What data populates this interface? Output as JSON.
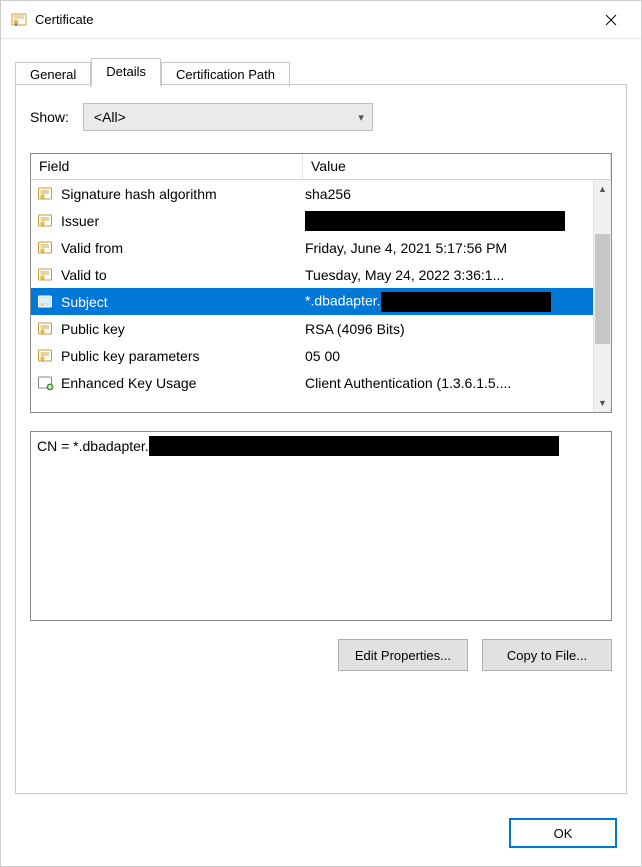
{
  "window": {
    "title": "Certificate"
  },
  "tabs": {
    "general": "General",
    "details": "Details",
    "certpath": "Certification Path"
  },
  "show": {
    "label": "Show:",
    "value": "<All>"
  },
  "columns": {
    "field": "Field",
    "value": "Value"
  },
  "rows": [
    {
      "field": "Signature hash algorithm",
      "value": "sha256",
      "icon": "cert-field-icon",
      "redacted": false
    },
    {
      "field": "Issuer",
      "value": "",
      "icon": "cert-field-icon",
      "redacted": true
    },
    {
      "field": "Valid from",
      "value": "Friday, June 4, 2021 5:17:56 PM",
      "icon": "cert-field-icon",
      "redacted": false
    },
    {
      "field": "Valid to",
      "value": "Tuesday, May 24, 2022 3:36:1...",
      "icon": "cert-field-icon",
      "redacted": false
    },
    {
      "field": "Subject",
      "value": "*.dbadapter.",
      "icon": "cert-field-icon",
      "redacted": "partial",
      "selected": true
    },
    {
      "field": "Public key",
      "value": "RSA (4096 Bits)",
      "icon": "cert-field-icon",
      "redacted": false
    },
    {
      "field": "Public key parameters",
      "value": "05 00",
      "icon": "cert-field-icon",
      "redacted": false
    },
    {
      "field": "Enhanced Key Usage",
      "value": "Client Authentication (1.3.6.1.5....",
      "icon": "ext-field-icon",
      "redacted": false
    }
  ],
  "detail": {
    "text": "CN = *.dbadapter."
  },
  "buttons": {
    "editprops": "Edit Properties...",
    "copytofile": "Copy to File...",
    "ok": "OK"
  }
}
